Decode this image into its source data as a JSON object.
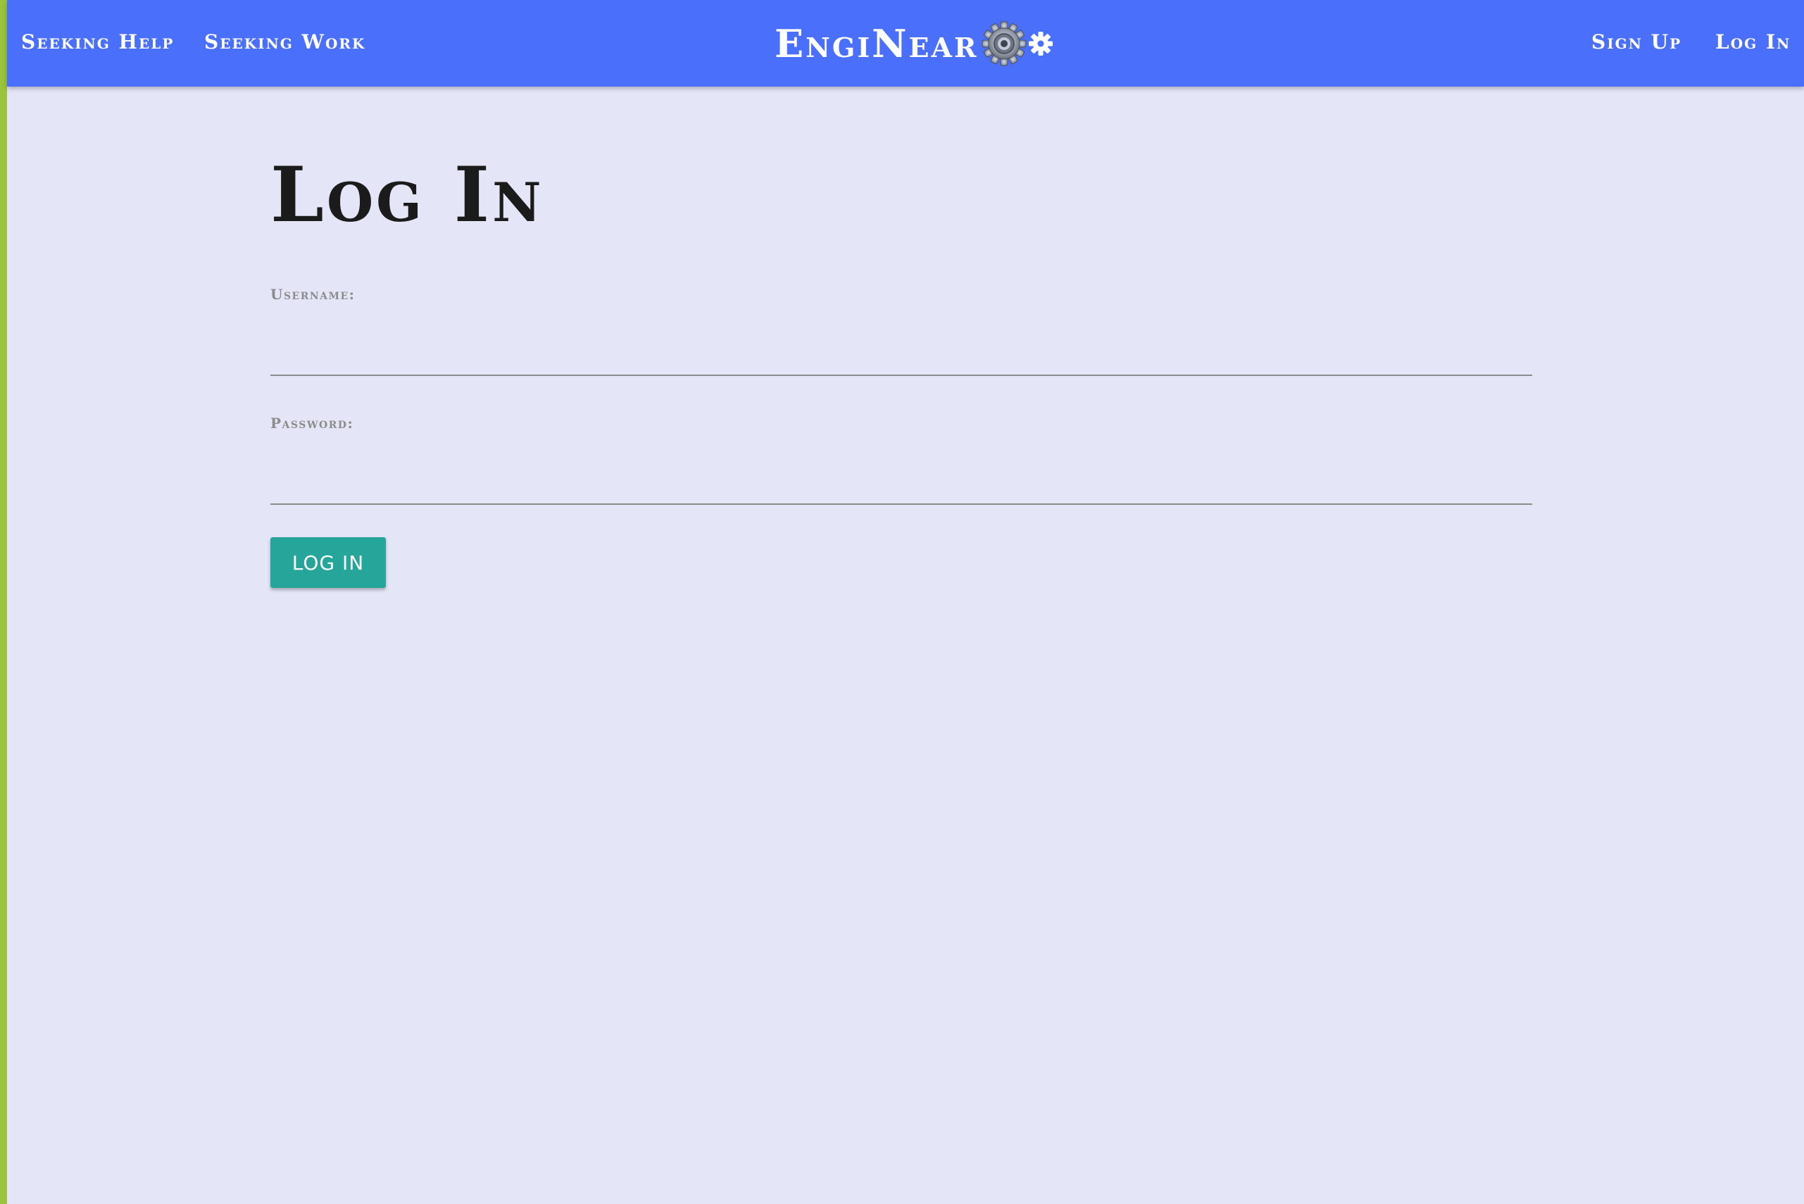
{
  "nav": {
    "left_links": [
      "Seeking Help",
      "Seeking Work"
    ],
    "brand": "EngiNear",
    "brand_icons": [
      "large-gear-icon",
      "small-gear-icon"
    ],
    "right_links": [
      "Sign Up",
      "Log In"
    ]
  },
  "page": {
    "title": "Log In"
  },
  "form": {
    "username_label": "Username:",
    "username_value": "",
    "password_label": "Password:",
    "password_value": "",
    "submit_label": "LOG IN"
  },
  "colors": {
    "navbar": "#4a70fb",
    "background": "#e4e6f8",
    "left_strip": "#9ac43c",
    "button": "#26a69a"
  }
}
